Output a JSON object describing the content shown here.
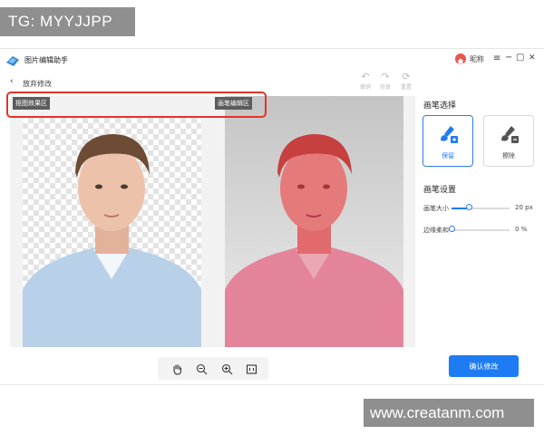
{
  "watermarks": {
    "top": "TG: MYYJJPP",
    "bottom": "www.creatanm.com"
  },
  "app": {
    "title": "图片编辑助手",
    "user_name": "昵称",
    "window_controls": [
      "≡",
      "−",
      "▢",
      "✕"
    ]
  },
  "nav": {
    "back_label": "放弃修改"
  },
  "history": {
    "undo": "撤销",
    "redo": "恢复",
    "reset": "重置"
  },
  "canvas": {
    "left_tag": "抠图效果区",
    "right_tag": "画笔编辑区"
  },
  "toolbar": {
    "tools": [
      "hand-icon",
      "zoom-out-icon",
      "zoom-in-icon",
      "fit-screen-icon"
    ]
  },
  "panel": {
    "brush_select_title": "画笔选择",
    "brushes": [
      {
        "label": "保留",
        "selected": true
      },
      {
        "label": "擦除",
        "selected": false
      }
    ],
    "settings_title": "画笔设置",
    "settings": [
      {
        "label": "画笔大小",
        "value": 20,
        "unit": "px",
        "display": "20 px",
        "fraction": 0.3
      },
      {
        "label": "边缘柔和",
        "value": 0,
        "unit": "%",
        "display": "0 %",
        "fraction": 0.0
      }
    ],
    "confirm_label": "确认修改"
  },
  "colors": {
    "accent": "#1e7cf2",
    "highlight": "#e2342a",
    "mask": "#e0575c"
  }
}
